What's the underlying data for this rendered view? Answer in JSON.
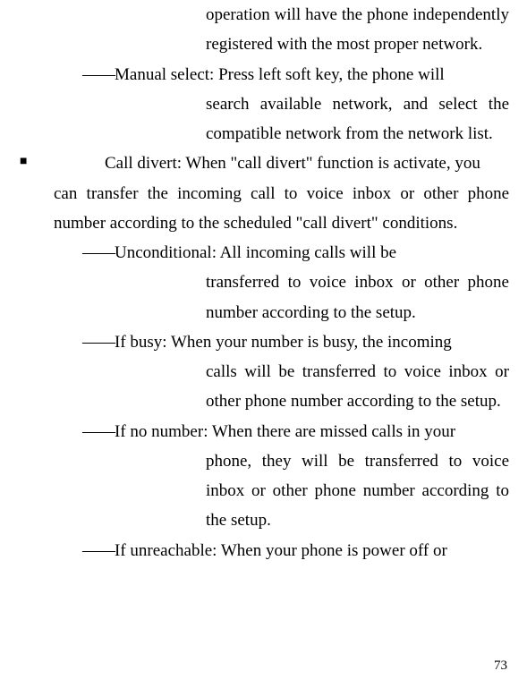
{
  "continuation1": "operation will have the phone independently registered with the most proper network.",
  "manualSelect": {
    "dash": "——",
    "label": "Manual select: Press left soft key, the phone will",
    "cont": "search available network, and select the compatible network from the network list."
  },
  "bullet": {
    "marker": "■",
    "firstLine": "Call divert: When \"call divert\" function is activate, you",
    "cont": "can transfer the incoming call to voice inbox or other phone number according to the scheduled \"call divert\" conditions."
  },
  "unconditional": {
    "dash": "——",
    "label": "Unconditional: All incoming calls will be",
    "cont": "transferred to voice inbox or other phone number according to the setup."
  },
  "ifBusy": {
    "dash": "——",
    "label": "If busy: When your number is busy, the incoming",
    "cont": "calls will be transferred to voice inbox or other phone number according to the setup."
  },
  "ifNoNumber": {
    "dash": "——",
    "label": "If no number: When there are missed calls in your",
    "cont": "phone, they will be transferred to voice inbox or other phone number according to the setup."
  },
  "ifUnreachable": {
    "dash": "——",
    "label": "If unreachable: When your phone is power off or"
  },
  "pageNumber": "73"
}
